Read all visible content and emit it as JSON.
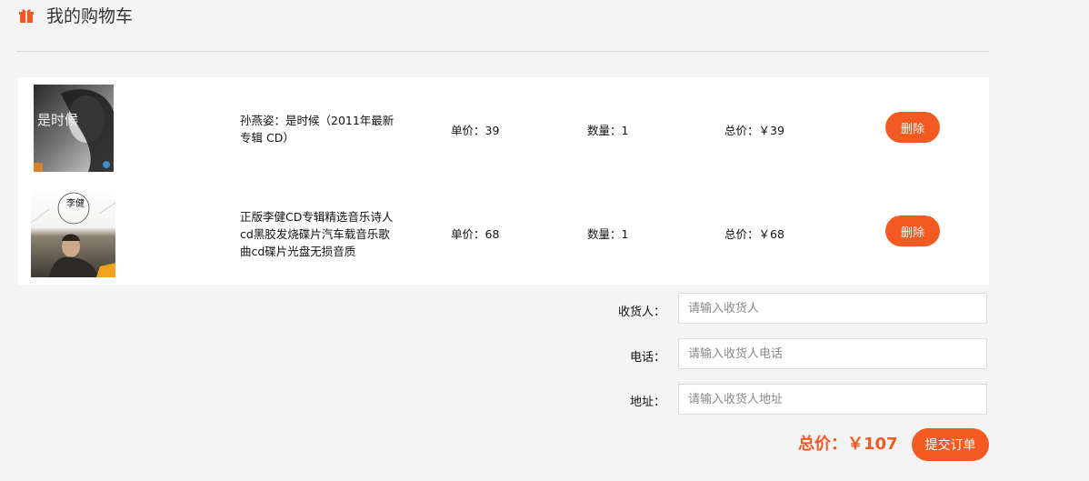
{
  "header": {
    "title": "我的购物车",
    "icon": "gift-icon",
    "accent": "#f25a22"
  },
  "cart": {
    "items": [
      {
        "name": "孙燕姿：是时候（2011年最新专辑 CD）",
        "unit_price_label": "单价：39",
        "quantity_label": "数量：1",
        "subtotal_label": "总价：￥39",
        "delete_label": "删除",
        "cover_text": "是时候"
      },
      {
        "name": "正版李健CD专辑精选音乐诗人cd黑胶发烧碟片汽车载音乐歌曲cd碟片光盘无损音质",
        "unit_price_label": "单价：68",
        "quantity_label": "数量：1",
        "subtotal_label": "总价：￥68",
        "delete_label": "删除",
        "cover_text": "李健"
      }
    ]
  },
  "form": {
    "receiver": {
      "label": "收货人：",
      "placeholder": "请输入收货人",
      "value": ""
    },
    "phone": {
      "label": "电话：",
      "placeholder": "请输入收货人电话",
      "value": ""
    },
    "address": {
      "label": "地址：",
      "placeholder": "请输入收货人地址",
      "value": ""
    }
  },
  "summary": {
    "total_label": "总价：￥107",
    "submit_label": "提交订单"
  }
}
